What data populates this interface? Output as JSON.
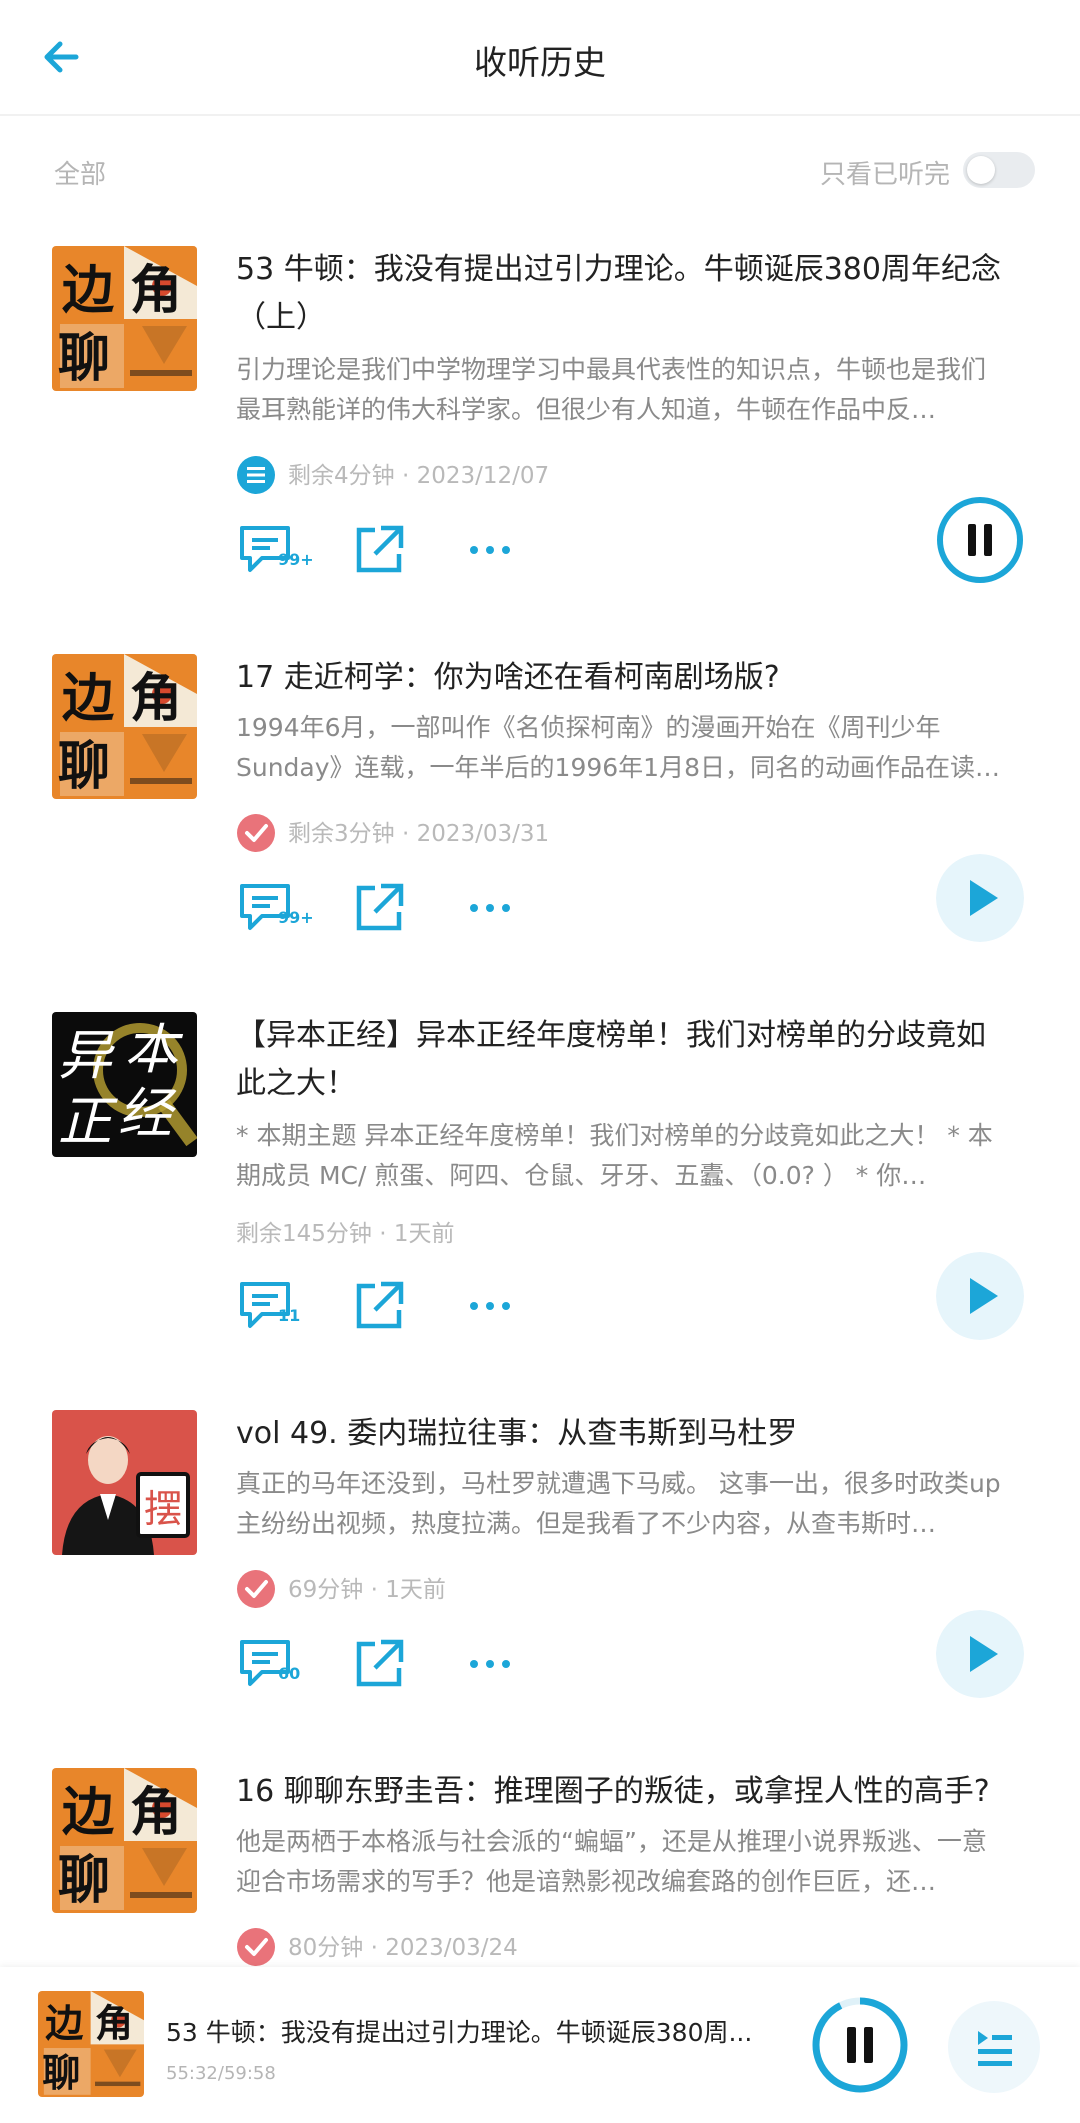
{
  "header": {
    "title": "收听历史",
    "back_icon": "arrow-left-icon"
  },
  "filter": {
    "all_label": "全部",
    "only_finished_label": "只看已听完",
    "only_finished_on": false
  },
  "accent_color": "#1ca6d8",
  "items": [
    {
      "title": "53 牛顿：我没有提出过引力理论。牛顿诞辰380周年纪念（上）",
      "desc": "引力理论是我们中学物理学习中最具代表性的知识点，牛顿也是我们最耳熟能详的伟大科学家。但很少有人知道，牛顿在作品中反…",
      "meta": "剩余4分钟 · 2023/12/07",
      "status_icon": "playing-list-icon",
      "comment_count": "99+",
      "playing": true,
      "cover": "biandian-cover"
    },
    {
      "title": "17 走近柯学：你为啥还在看柯南剧场版?",
      "desc": "1994年6月，一部叫作《名侦探柯南》的漫画开始在《周刊少年Sunday》连载，一年半后的1996年1月8日，同名的动画作品在读…",
      "meta": "剩余3分钟 · 2023/03/31",
      "status_icon": "check-icon",
      "comment_count": "99+",
      "playing": false,
      "cover": "biandian-cover"
    },
    {
      "title": "【异本正经】异本正经年度榜单！我们对榜单的分歧竟如此之大！",
      "desc": "* 本期主题 异本正经年度榜单！我们对榜单的分歧竟如此之大！ * 本期成员 MC/ 煎蛋、阿四、仓鼠、牙牙、五蠹、（0.0? ） * 你…",
      "meta": "剩余145分钟 · 1天前",
      "status_icon": "",
      "comment_count": "11",
      "playing": false,
      "cover": "yiben-cover"
    },
    {
      "title": "vol 49. 委内瑞拉往事：从查韦斯到马杜罗",
      "desc": "真正的马年还没到，马杜罗就遭遇下马威。 这事一出，很多时政类up主纷纷出视频，热度拉满。但是我看了不少内容，从查韦斯时…",
      "meta": "69分钟 · 1天前",
      "status_icon": "check-icon",
      "comment_count": "60",
      "playing": false,
      "cover": "bai-cover"
    },
    {
      "title": "16 聊聊东野圭吾：推理圈子的叛徒，或拿捏人性的高手?",
      "desc": "他是两栖于本格派与社会派的“蝙蝠”，还是从推理小说界叛逃、一意迎合市场需求的写手？他是谙熟影视改编套路的创作巨匠，还…",
      "meta": "80分钟 · 2023/03/24",
      "status_icon": "check-icon",
      "comment_count": "",
      "playing": false,
      "cover": "biandian-cover"
    }
  ],
  "cover_text": {
    "bai": "摆",
    "yiben_1": "异",
    "yiben_2": "本",
    "yiben_3": "正",
    "yiben_4": "经",
    "bd_1": "边",
    "bd_2": "角",
    "bd_3": "聊"
  },
  "player": {
    "title": "53 牛顿：我没有提出过引力理论。牛顿诞辰380周...",
    "time": "55:32/59:58",
    "progress": 0.926
  }
}
